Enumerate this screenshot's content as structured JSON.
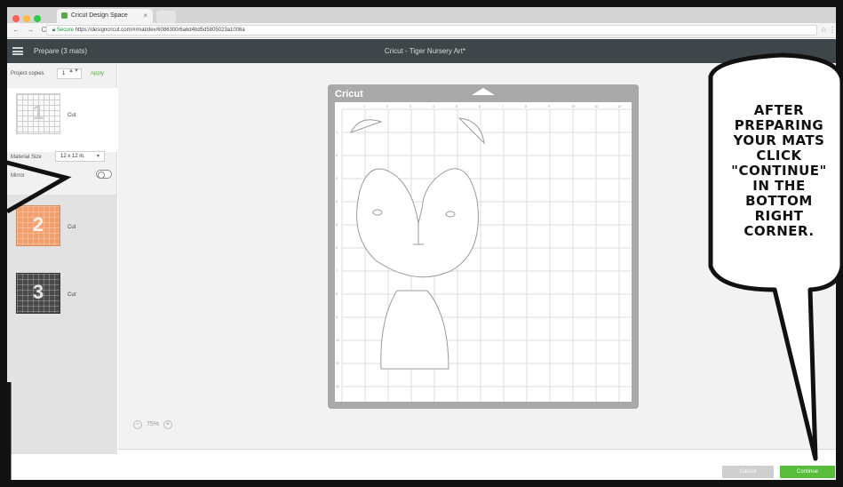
{
  "browser": {
    "tab_title": "Cricut Design Space",
    "tab_close": "×",
    "nav_buttons": "← → C",
    "url_secure_label": "Secure",
    "url": "https://designcricut.com/#/mat/dev/6086300/6a6d4bd5d5805023a1006a",
    "url_right": "☆ ⋮"
  },
  "app": {
    "left_title": "Prepare (3 mats)",
    "center_title": "Cricut - Tiger Nursery Art*"
  },
  "sidebar": {
    "project_copies_label": "Project copies",
    "project_copies_value": "1",
    "spin": "▲▼",
    "apply_label": "Apply",
    "mats": [
      {
        "number": "1",
        "label": "Cut"
      },
      {
        "number": "2",
        "label": "Cut"
      },
      {
        "number": "3",
        "label": "Cut"
      }
    ],
    "material_size_label": "Material Size",
    "material_size_value": "12 x 12 in.",
    "caret": "▼",
    "mirror_label": "Mirror"
  },
  "canvas": {
    "mat_brand": "Cricut",
    "ruler_top": [
      "1",
      "2",
      "3",
      "4",
      "5",
      "6",
      "7",
      "8",
      "9",
      "10",
      "11",
      "12"
    ],
    "ruler_left": [
      "1",
      "2",
      "3",
      "4",
      "5",
      "6",
      "7",
      "8",
      "9",
      "10",
      "11",
      "12"
    ],
    "zoom_minus": "−",
    "zoom_value": "75%",
    "zoom_plus": "+"
  },
  "footer": {
    "cancel_label": "Cancel",
    "continue_label": "Continue"
  },
  "callout": {
    "text": "AFTER PREPARING YOUR MATS CLICK \"CONTINUE\" IN THE BOTTOM RIGHT CORNER."
  },
  "colors": {
    "appbar": "#3f4649",
    "continue_green": "#58bd3a",
    "mat_orange": "#f0a070",
    "mat_dark": "#4a4a4a"
  }
}
